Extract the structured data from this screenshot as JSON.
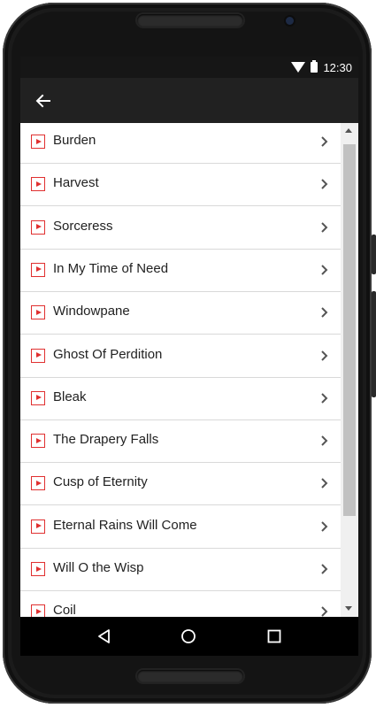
{
  "status_bar": {
    "time": "12:30",
    "icons": [
      "wifi-icon",
      "battery-icon"
    ]
  },
  "app_bar": {
    "back_icon": "arrow-left-icon"
  },
  "list": {
    "item_icon": "play-icon",
    "trailing_icon": "chevron-right-icon",
    "accent_color": "#e03030",
    "items": [
      {
        "label": "Burden"
      },
      {
        "label": "Harvest"
      },
      {
        "label": "Sorceress"
      },
      {
        "label": "In My Time of Need"
      },
      {
        "label": "Windowpane"
      },
      {
        "label": "Ghost Of Perdition"
      },
      {
        "label": "Bleak"
      },
      {
        "label": "The Drapery Falls"
      },
      {
        "label": "Cusp of Eternity"
      },
      {
        "label": "Eternal Rains Will Come"
      },
      {
        "label": "Will O the Wisp"
      },
      {
        "label": "Coil"
      }
    ]
  },
  "nav_bar": {
    "buttons": [
      "back-triangle-icon",
      "home-circle-icon",
      "recents-square-icon"
    ]
  },
  "colors": {
    "app_bar": "#212121",
    "status_bar": "#161616",
    "list_background": "#ffffff"
  }
}
